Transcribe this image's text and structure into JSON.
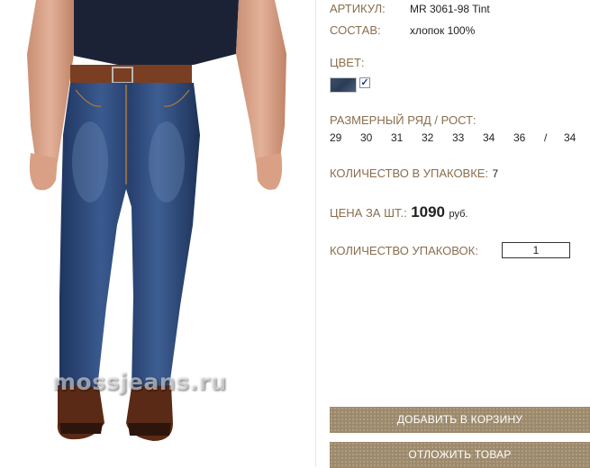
{
  "product": {
    "watermark": "mossjeans.ru",
    "article_label": "АРТИКУЛ:",
    "article_value": "MR 3061-98 Tint",
    "composition_label": "СОСТАВ:",
    "composition_value": "хлопок 100%",
    "color_label": "ЦВЕТ:",
    "color_swatch": "#34465f",
    "color_checked_mark": "✓",
    "size_label": "РАЗМЕРНЫЙ РЯД / РОСТ:",
    "sizes": [
      "29",
      "30",
      "31",
      "32",
      "33",
      "34",
      "36"
    ],
    "size_separator": "/",
    "height": "34",
    "pack_qty_label": "КОЛИЧЕСТВО В УПАКОВКЕ:",
    "pack_qty_value": "7",
    "price_label": "ЦЕНА ЗА ШТ.:",
    "price_value": "1090",
    "price_currency": "руб.",
    "packs_label": "КОЛИЧЕСТВО УПАКОВОК:",
    "packs_value": "1"
  },
  "actions": {
    "add_to_cart": "ДОБАВИТЬ В КОРЗИНУ",
    "postpone": "ОТЛОЖИТЬ ТОВАР"
  },
  "colors": {
    "label": "#8a6d4e",
    "button": "#9d8a6c",
    "denim": "#2f4a78"
  }
}
